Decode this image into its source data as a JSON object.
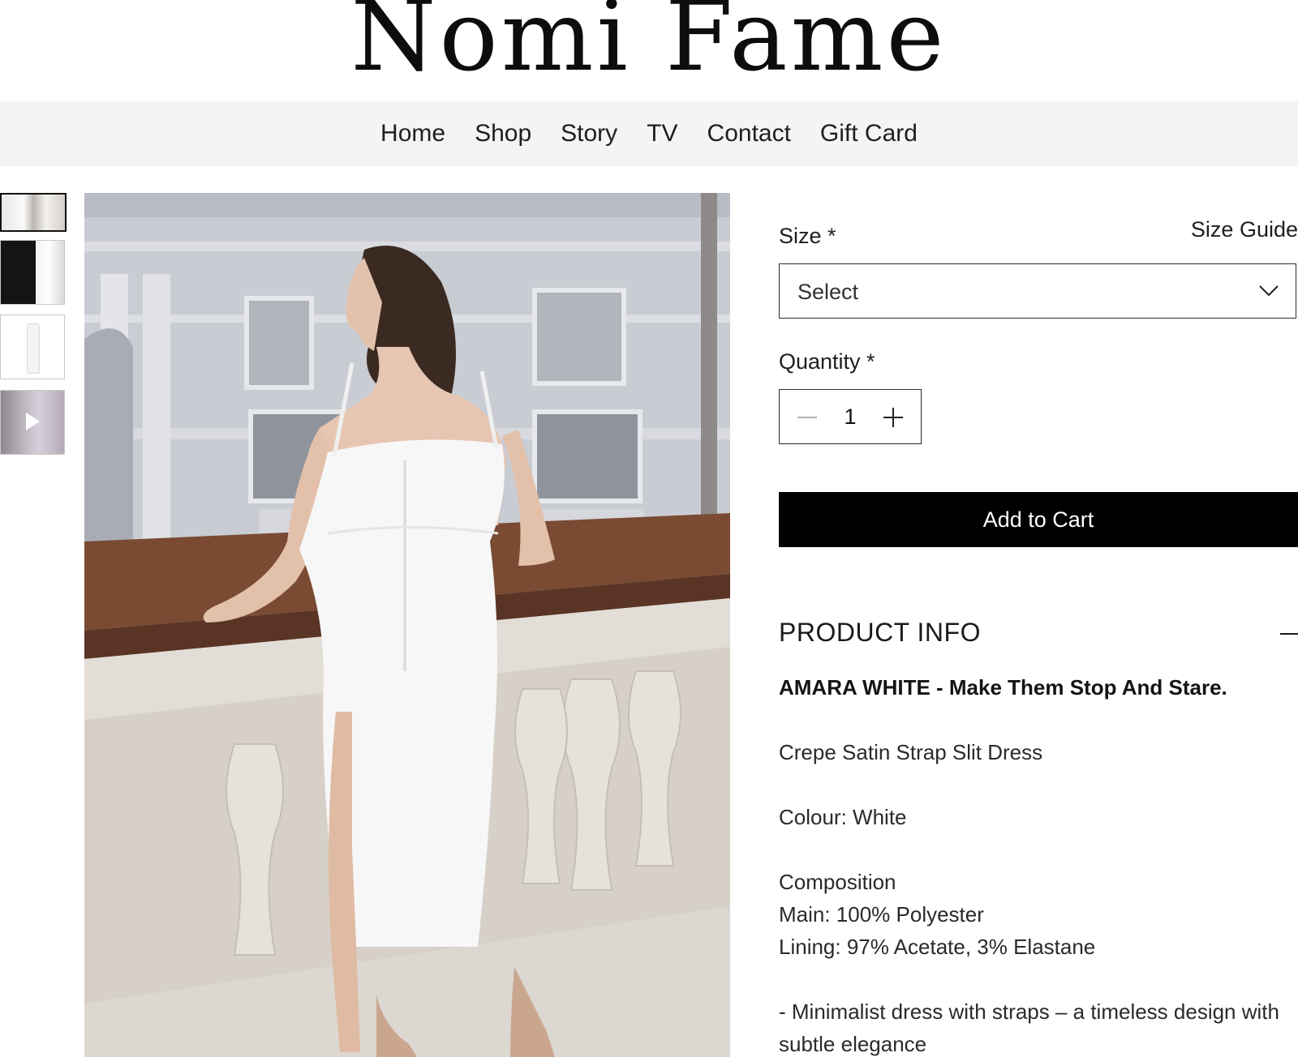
{
  "brand": {
    "name": "Nomi Fame"
  },
  "nav": {
    "items": [
      "Home",
      "Shop",
      "Story",
      "TV",
      "Contact",
      "Gift Card"
    ]
  },
  "gallery": {
    "thumbnails": [
      "image",
      "image",
      "image",
      "video"
    ],
    "selected_index": 0
  },
  "product": {
    "size_label": "Size *",
    "size_guide": "Size Guide",
    "size_placeholder": "Select",
    "quantity_label": "Quantity *",
    "quantity": "1",
    "add_to_cart": "Add to Cart",
    "info_title": "PRODUCT INFO",
    "headline": "AMARA WHITE - Make Them Stop And Stare.",
    "description": "Crepe Satin Strap Slit Dress",
    "colour": "Colour: White",
    "composition_title": "Composition",
    "composition_main": "Main: 100% Polyester",
    "composition_lining": "Lining: 97% Acetate, 3% Elastane",
    "feature_1": "- Minimalist dress with straps – a timeless design with subtle elegance"
  },
  "icons": {
    "dropdown": "chevron-down-icon",
    "decrement": "minus-icon",
    "increment": "plus-icon",
    "collapse": "collapse-minus-icon",
    "video": "play-icon"
  },
  "colors": {
    "button_bg": "#000000",
    "button_text": "#ffffff",
    "nav_bg": "#f4f4f4"
  }
}
